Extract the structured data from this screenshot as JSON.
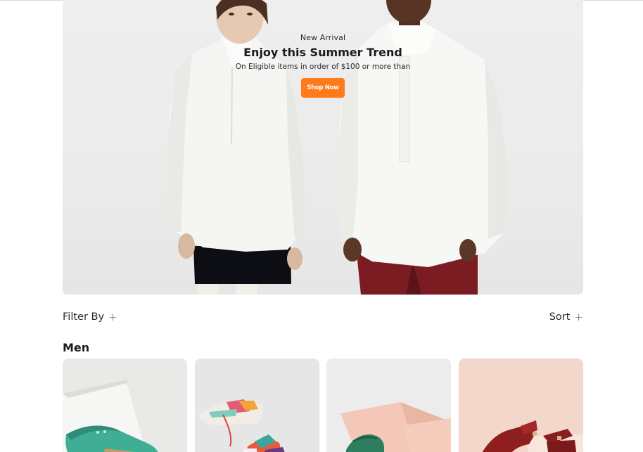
{
  "hero": {
    "eyebrow": "New Arrival",
    "title": "Enjoy this Summer Trend",
    "subtitle": "On Eligible items in order of $100 or more than",
    "cta_label": "Shop Now",
    "accent_color": "#ff7a1a"
  },
  "toolbar": {
    "filter_label": "Filter By",
    "filter_icon": "+",
    "sort_label": "Sort",
    "sort_icon": "+"
  },
  "section": {
    "title": "Men"
  },
  "products": [
    {
      "image": "teal-brogue-shoe"
    },
    {
      "image": "colorful-sneakers"
    },
    {
      "image": "green-loafer-pink-props"
    },
    {
      "image": "red-sandal-pink-background"
    }
  ]
}
